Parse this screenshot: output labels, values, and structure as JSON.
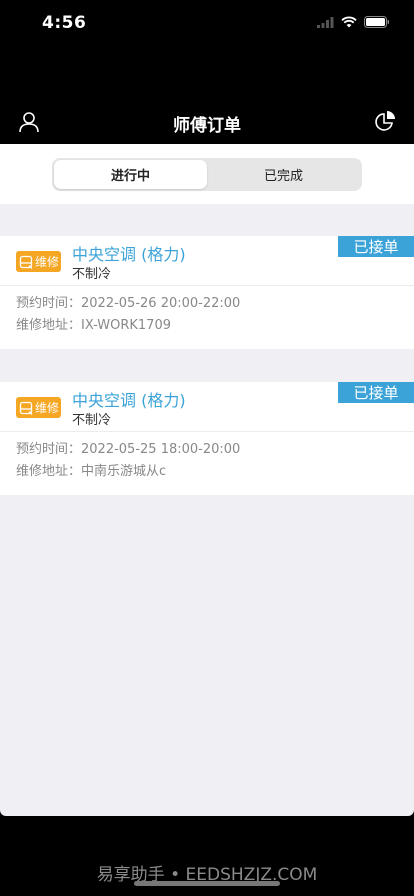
{
  "status_bar": {
    "time": "4:56"
  },
  "nav": {
    "title": "师傅订单"
  },
  "tabs": [
    {
      "label": "进行中",
      "active": true
    },
    {
      "label": "已完成",
      "active": false
    }
  ],
  "orders": [
    {
      "badge": "维修",
      "product": "中央空调 (格力)",
      "issue": "不制冷",
      "status": "已接单",
      "time_label": "预约时间：",
      "time_value": "2022-05-26 20:00-22:00",
      "address_label": "维修地址：",
      "address_value": "IX-WORK1709"
    },
    {
      "badge": "维修",
      "product": "中央空调 (格力)",
      "issue": "不制冷",
      "status": "已接单",
      "time_label": "预约时间：",
      "time_value": "2022-05-25 18:00-20:00",
      "address_label": "维修地址：",
      "address_value": "中南乐游城从c"
    }
  ],
  "watermark": "易享助手 • EEDSHZJZ.COM",
  "colors": {
    "accent": "#3ba3d8",
    "badge": "#f5a623",
    "background": "#efeff4"
  }
}
